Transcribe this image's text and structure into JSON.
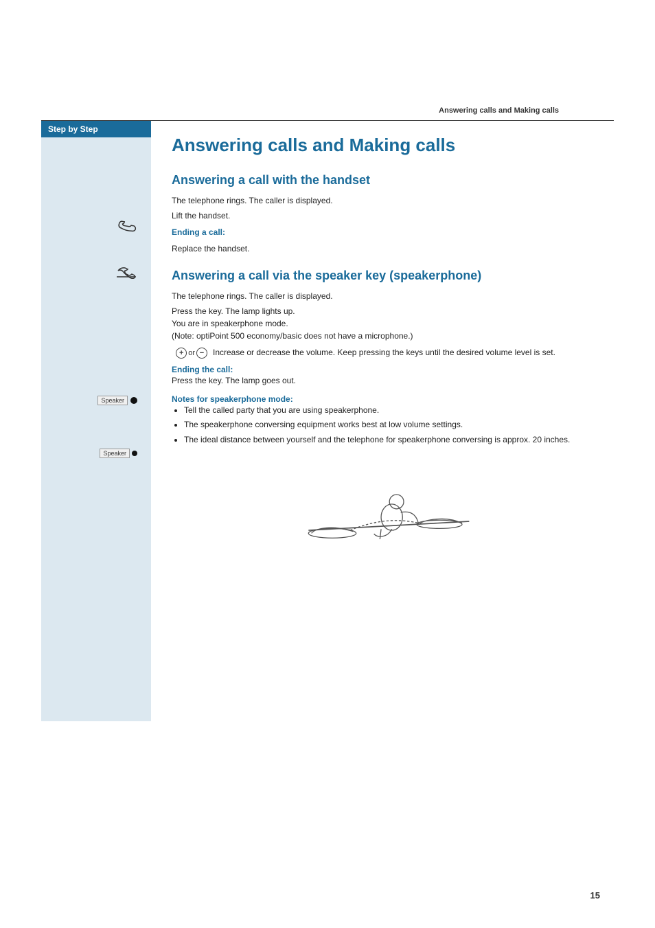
{
  "header": {
    "title": "Answering calls and Making calls"
  },
  "sidebar": {
    "step_by_step": "Step by Step"
  },
  "content": {
    "page_title": "Answering calls and Making calls",
    "section1": {
      "title": "Answering a call with the handset",
      "intro": "The telephone rings. The caller is displayed.",
      "step1": "Lift the handset.",
      "ending_label": "Ending a call:",
      "step2": "Replace the handset."
    },
    "section2": {
      "title": "Answering a call via the speaker key (speakerphone)",
      "intro": "The telephone rings. The caller is displayed.",
      "step1": "Press the key. The lamp lights up.\nYou are in speakerphone mode.\n(Note: optiPoint 500 economy/basic does not have a microphone.)",
      "step2": "Increase or decrease the volume. Keep pressing the keys until the desired volume level is set.",
      "ending_label": "Ending the call:",
      "step3": "Press the key. The lamp goes out.",
      "notes_label": "Notes for speakerphone mode:",
      "notes": [
        "Tell the called party that you are using speakerphone.",
        "The speakerphone conversing equipment works best at low volume settings.",
        "The ideal distance between yourself and the telephone for speakerphone conversing is approx. 20 inches."
      ]
    }
  },
  "page_number": "15"
}
